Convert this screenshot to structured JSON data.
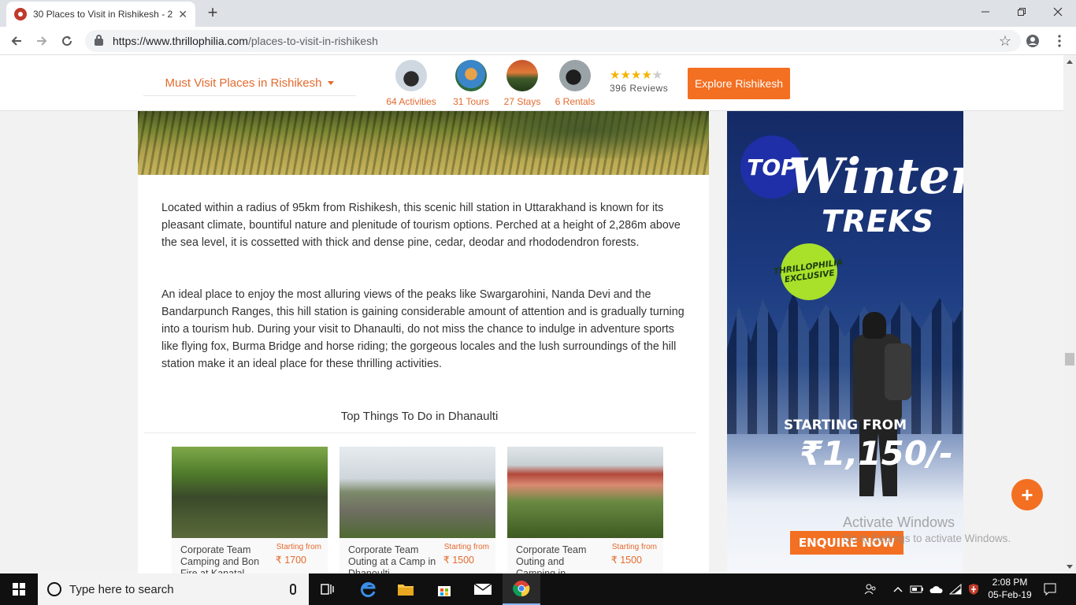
{
  "browser": {
    "tab_title": "30 Places to Visit in Rishikesh - 2",
    "tab_close": "✕",
    "new_tab": "+",
    "url_host": "https://www.thrillophilia.com",
    "url_path": "/places-to-visit-in-rishikesh",
    "icons": [
      "back-icon",
      "forward-icon",
      "reload-icon",
      "lock-icon",
      "star-icon",
      "profile-icon",
      "menu-icon"
    ]
  },
  "header": {
    "dropdown_label": "Must Visit Places in Rishikesh",
    "stats": [
      {
        "label": "64 Activities"
      },
      {
        "label": "31 Tours"
      },
      {
        "label": "27 Stays"
      },
      {
        "label": "6 Rentals"
      }
    ],
    "rating": 4,
    "rating_max": 5,
    "reviews": "396 Reviews",
    "explore_label": "Explore Rishikesh"
  },
  "article": {
    "paragraph1": "Located within a radius of 95km from Rishikesh, this scenic hill station in Uttarakhand is known for its pleasant climate, bountiful nature and plenitude of tourism options. Perched at a height of 2,286m above the sea level, it is cossetted with thick and dense pine, cedar, deodar and rhododendron forests.",
    "paragraph2": "An ideal place to enjoy the most alluring views of the peaks like Swargarohini, Nanda Devi and the Bandarpunch Ranges, this hill station is gaining considerable amount of attention and is gradually turning into a tourism hub. During your visit to Dhanaulti, do not miss the chance to indulge in adventure sports like flying fox, Burma Bridge and horse riding; the gorgeous locales and the lush surroundings of the hill station make it an ideal place for these thrilling activities.",
    "section_title": "Top Things To Do in Dhanaulti"
  },
  "cards": [
    {
      "title": "Corporate Team Camping and Bon Fire at Kanatal",
      "from_label": "Starting from",
      "price": "₹ 1700"
    },
    {
      "title": "Corporate Team Outing at a Camp in Dhanoulti",
      "from_label": "Starting from",
      "price": "₹ 1500"
    },
    {
      "title": "Corporate Team Outing and Camping in",
      "from_label": "Starting from",
      "price": "₹ 1500"
    }
  ],
  "ad": {
    "top": "TOP",
    "winter": "Winter",
    "treks": "TREKS",
    "badge": "THRILLOPHILIA EXCLUSIVE",
    "starting_from": "STARTING FROM",
    "price": "₹1,150/-",
    "enquire": "ENQUIRE NOW"
  },
  "fab_label": "+",
  "watermark": {
    "line1": "Activate Windows",
    "line2": "Go to Settings to activate Windows."
  },
  "taskbar": {
    "search_placeholder": "Type here to search",
    "time": "2:08 PM",
    "date": "05-Feb-19"
  },
  "colors": {
    "accent": "#f36f21",
    "accent_text": "#e46a2e",
    "star": "#f4b400"
  }
}
